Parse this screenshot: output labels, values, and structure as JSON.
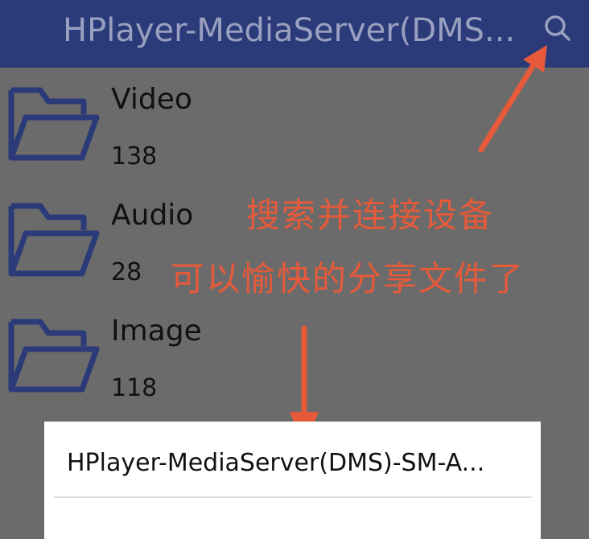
{
  "appbar": {
    "title": "HPlayer-MediaServer(DMS...",
    "search_icon": "search-icon"
  },
  "folders": [
    {
      "name": "Video",
      "count": "138",
      "icon": "folder-icon"
    },
    {
      "name": "Audio",
      "count": "28",
      "icon": "folder-icon"
    },
    {
      "name": "Image",
      "count": "118",
      "icon": "folder-icon"
    }
  ],
  "annotations": {
    "line1": "搜索并连接设备",
    "line2": "可以愉快的分享文件了"
  },
  "dialog": {
    "items": [
      {
        "label": "HPlayer-MediaServer(DMS)-SM-A..."
      }
    ]
  },
  "colors": {
    "appbar": "#2b3a78",
    "overlay": "#6b6b6b",
    "folder_icon": "#2b3a78",
    "annotation": "#e65a3a"
  }
}
